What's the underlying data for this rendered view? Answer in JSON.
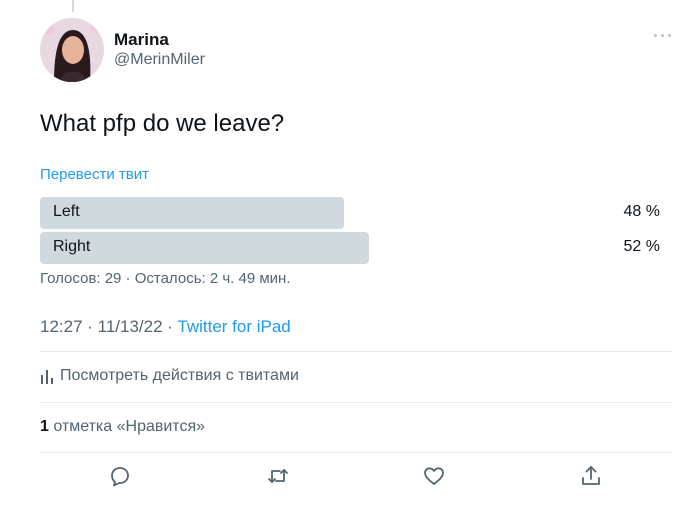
{
  "tweet": {
    "author_name": "Marina",
    "author_handle": "@MerinMiler",
    "text": "What pfp do we leave?",
    "translate_label": "Перевести твит",
    "poll": {
      "options": [
        {
          "label": "Left",
          "percent_text": "48 %",
          "percent": 48
        },
        {
          "label": "Right",
          "percent_text": "52 %",
          "percent": 52
        }
      ],
      "meta": "Голосов: 29 · Осталось: 2 ч. 49 мин."
    },
    "time": "12:27 · 11/13/22 · ",
    "source": "Twitter for iPad",
    "activity_label": "Посмотреть действия с твитами",
    "likes_count": "1",
    "likes_label": " отметка «Нравится»"
  },
  "icons": {
    "more": "more-icon",
    "analytics": "analytics-icon",
    "reply": "reply-icon",
    "retweet": "retweet-icon",
    "like": "heart-icon",
    "share": "share-icon"
  },
  "colors": {
    "accent": "#1d9bf0",
    "poll_bar": "#cfd9de",
    "secondary_text": "#536471"
  }
}
